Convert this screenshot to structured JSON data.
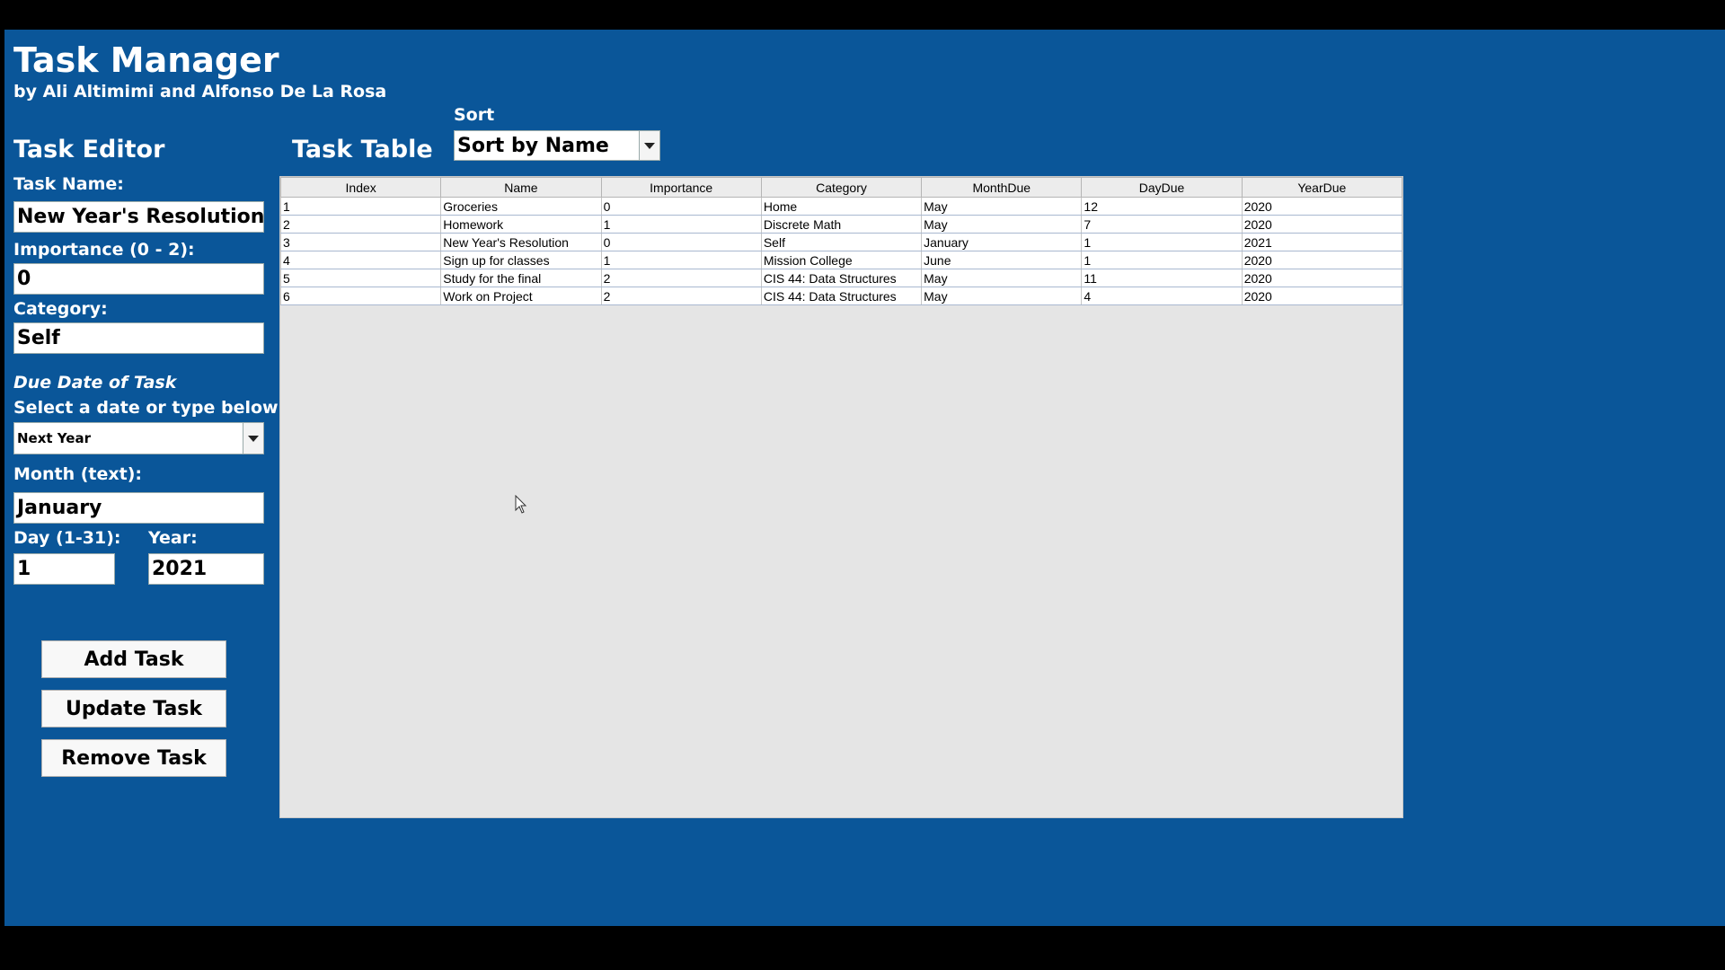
{
  "header": {
    "title": "Task Manager",
    "subtitle": "by Ali Altimimi and Alfonso De La Rosa"
  },
  "editor": {
    "heading": "Task Editor",
    "task_name_label": "Task Name:",
    "task_name_value": "New Year's Resolution",
    "importance_label": "Importance (0 - 2):",
    "importance_value": "0",
    "category_label": "Category:",
    "category_value": "Self",
    "due_date_heading": "Due Date of Task",
    "select_date_label": "Select a date or type below:",
    "date_preset_value": "Next Year",
    "month_label": "Month (text):",
    "month_value": "January",
    "day_label": "Day (1-31):",
    "day_value": "1",
    "year_label": "Year:",
    "year_value": "2021"
  },
  "buttons": {
    "add": "Add Task",
    "update": "Update Task",
    "remove": "Remove Task"
  },
  "table_section": {
    "heading": "Task Table",
    "sort_label": "Sort",
    "sort_value": "Sort by Name"
  },
  "table": {
    "columns": [
      "Index",
      "Name",
      "Importance",
      "Category",
      "MonthDue",
      "DayDue",
      "YearDue"
    ],
    "rows": [
      [
        "1",
        "Groceries",
        "0",
        "Home",
        "May",
        "12",
        "2020"
      ],
      [
        "2",
        "Homework",
        "1",
        "Discrete Math",
        "May",
        "7",
        "2020"
      ],
      [
        "3",
        "New Year's Resolution",
        "0",
        "Self",
        "January",
        "1",
        "2021"
      ],
      [
        "4",
        "Sign up for classes",
        "1",
        "Mission College",
        "June",
        "1",
        "2020"
      ],
      [
        "5",
        "Study for the final",
        "2",
        "CIS 44: Data Structures",
        "May",
        "11",
        "2020"
      ],
      [
        "6",
        "Work on Project",
        "2",
        "CIS 44: Data Structures",
        "May",
        "4",
        "2020"
      ]
    ]
  },
  "colors": {
    "app_background": "#0a5699",
    "screen_border": "#000000",
    "table_area": "#e5e5e5"
  },
  "icons": {
    "dropdown": "chevron-down-icon",
    "cursor": "mouse-cursor-icon"
  }
}
